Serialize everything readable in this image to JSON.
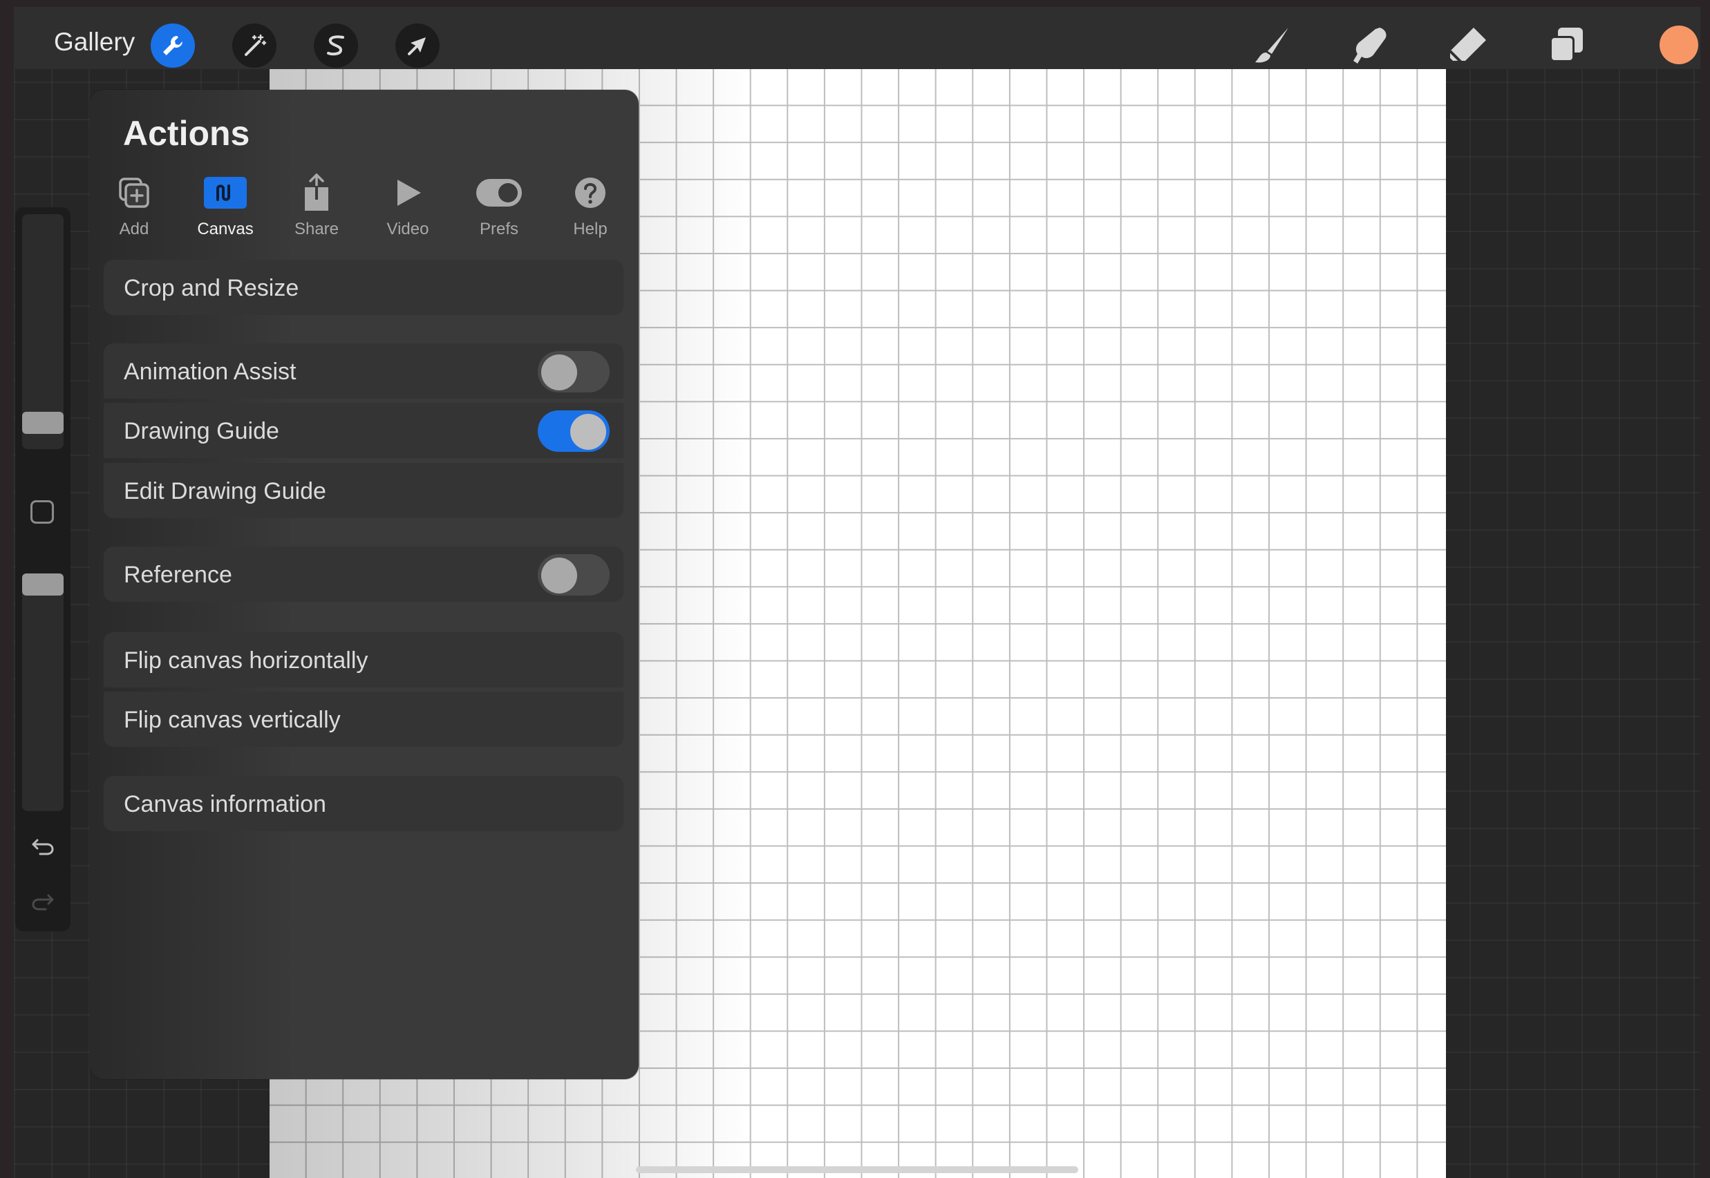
{
  "topbar": {
    "gallery_label": "Gallery",
    "left_tools": [
      {
        "name": "actions",
        "icon": "wrench-icon",
        "active": true
      },
      {
        "name": "adjustments",
        "icon": "magic-wand-icon"
      },
      {
        "name": "selection",
        "icon": "selection-s-icon"
      },
      {
        "name": "transform",
        "icon": "arrow-cursor-icon"
      }
    ],
    "right_tools": [
      {
        "name": "brush",
        "icon": "brush-icon"
      },
      {
        "name": "smudge",
        "icon": "smudge-finger-icon"
      },
      {
        "name": "eraser",
        "icon": "eraser-icon"
      },
      {
        "name": "layers",
        "icon": "layers-icon"
      }
    ],
    "current_color": "#F79766"
  },
  "actions_panel": {
    "title": "Actions",
    "tabs": [
      {
        "label": "Add",
        "icon": "add-icon"
      },
      {
        "label": "Canvas",
        "icon": "canvas-icon",
        "active": true
      },
      {
        "label": "Share",
        "icon": "share-icon"
      },
      {
        "label": "Video",
        "icon": "play-icon"
      },
      {
        "label": "Prefs",
        "icon": "toggle-icon"
      },
      {
        "label": "Help",
        "icon": "help-icon"
      }
    ],
    "items": {
      "crop_resize": "Crop and Resize",
      "animation_assist": {
        "label": "Animation Assist",
        "on": false
      },
      "drawing_guide": {
        "label": "Drawing Guide",
        "on": true
      },
      "edit_drawing_guide": "Edit Drawing Guide",
      "reference": {
        "label": "Reference",
        "on": false
      },
      "flip_horizontal": "Flip canvas horizontally",
      "flip_vertical": "Flip canvas vertically",
      "canvas_information": "Canvas information"
    }
  },
  "sidebar": {
    "tools": [
      "brush-size-slider",
      "modify-button",
      "brush-opacity-slider",
      "undo-icon",
      "redo-icon"
    ]
  },
  "colors": {
    "accent": "#1A72E8",
    "panel": "#3A3A3A",
    "row": "#343434"
  }
}
